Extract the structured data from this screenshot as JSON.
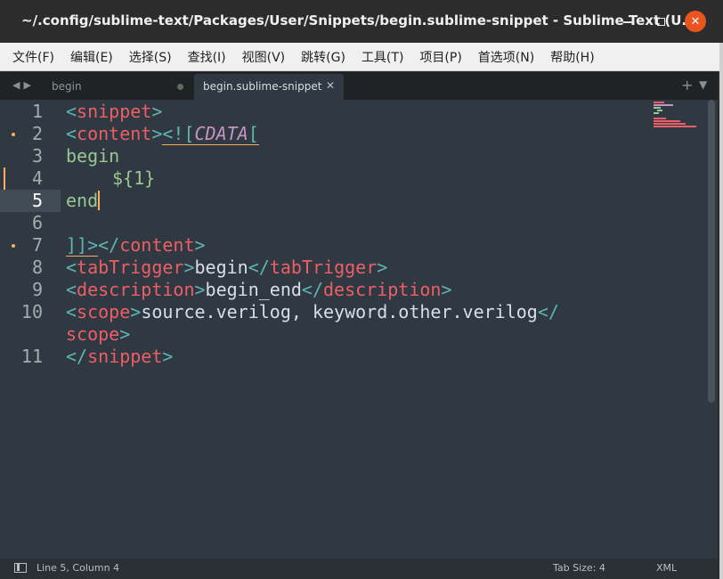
{
  "window": {
    "title": "~/.config/sublime-text/Packages/User/Snippets/begin.sublime-snippet - Sublime Text (U..."
  },
  "menu": [
    "文件(F)",
    "编辑(E)",
    "选择(S)",
    "查找(I)",
    "视图(V)",
    "跳转(G)",
    "工具(T)",
    "项目(P)",
    "首选项(N)",
    "帮助(H)"
  ],
  "tabs": [
    {
      "label": "begin",
      "active": false,
      "modified": true
    },
    {
      "label": "begin.sublime-snippet",
      "active": true,
      "modified": false
    }
  ],
  "editor": {
    "line_numbers": [
      "1",
      "2",
      "3",
      "4",
      "5",
      "6",
      "7",
      "8",
      "9",
      "10",
      "",
      "11"
    ],
    "current_line": "5",
    "gutter_markers": {
      "modified_dots": [
        "2",
        "7"
      ],
      "changed_bar": [
        "4"
      ]
    },
    "tokens": {
      "l1": [
        "<",
        "snippet",
        ">"
      ],
      "l2": [
        "<",
        "content",
        ">",
        "<![",
        "CDATA",
        "["
      ],
      "l3": "begin",
      "l4": "${1}",
      "l5": "end",
      "l7": [
        "]]>",
        "</",
        "content",
        ">"
      ],
      "l8": [
        "<",
        "tabTrigger",
        ">",
        "begin",
        "</",
        "tabTrigger",
        ">"
      ],
      "l9": [
        "<",
        "description",
        ">",
        "begin_end",
        "</",
        "description",
        ">"
      ],
      "l10": [
        "<",
        "scope",
        ">",
        "source.verilog, keyword.other.verilog",
        "</"
      ],
      "l10b": [
        "scope",
        ">"
      ],
      "l11": [
        "</",
        "snippet",
        ">"
      ]
    }
  },
  "status": {
    "position": "Line 5, Column 4",
    "tab_size": "Tab Size: 4",
    "syntax": "XML"
  },
  "colors": {
    "editor_bg": "#303841",
    "tag": "#ec5f66",
    "bracket": "#5fb4b4",
    "string": "#99c794",
    "cdata": "#c594c5",
    "accent": "#f9ae58",
    "close_button": "#e9541f"
  },
  "icons": {
    "window_minimize": "minimize-icon",
    "window_maximize": "maximize-icon",
    "window_close": "close-icon",
    "tab_close": "close-icon",
    "new_tab": "plus-icon",
    "tab_dropdown": "chevron-down-icon",
    "nav_back": "chevron-left-icon",
    "nav_forward": "chevron-right-icon",
    "sidebar_toggle": "sidebar-icon"
  }
}
